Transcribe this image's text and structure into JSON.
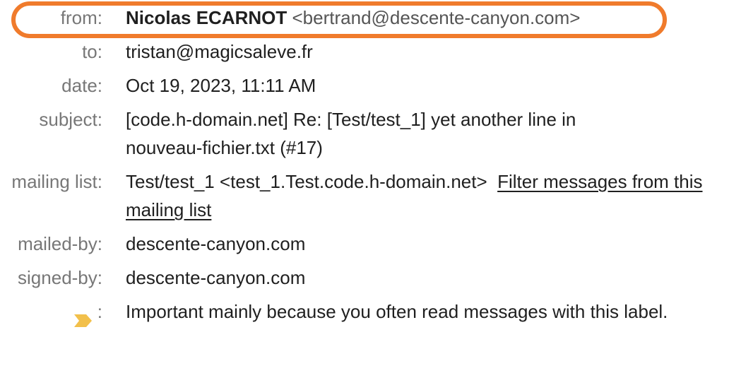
{
  "header": {
    "from_label": "from:",
    "from_name": "Nicolas ECARNOT",
    "from_email": "<bertrand@descente-canyon.com>",
    "to_label": "to:",
    "to_value": "tristan@magicsaleve.fr",
    "date_label": "date:",
    "date_value": "Oct 19, 2023, 11:11 AM",
    "subject_label": "subject:",
    "subject_value": "[code.h-domain.net] Re: [Test/test_1] yet another line in nouveau-fichier.txt (#17)",
    "mailing_list_label": "mailing list:",
    "mailing_list_value": "Test/test_1 <test_1.Test.code.h-domain.net>",
    "mailing_list_link": "Filter messages from this mailing list",
    "mailed_by_label": "mailed-by:",
    "mailed_by_value": "descente-canyon.com",
    "signed_by_label": "signed-by:",
    "signed_by_value": "descente-canyon.com",
    "importance_label": ":",
    "importance_icon": "importance-marker-icon",
    "importance_value": "Important mainly because you often read messages with this label."
  },
  "colors": {
    "highlight": "#f07b2c",
    "importance_marker": "#f2c04b",
    "label_text": "#777777"
  }
}
